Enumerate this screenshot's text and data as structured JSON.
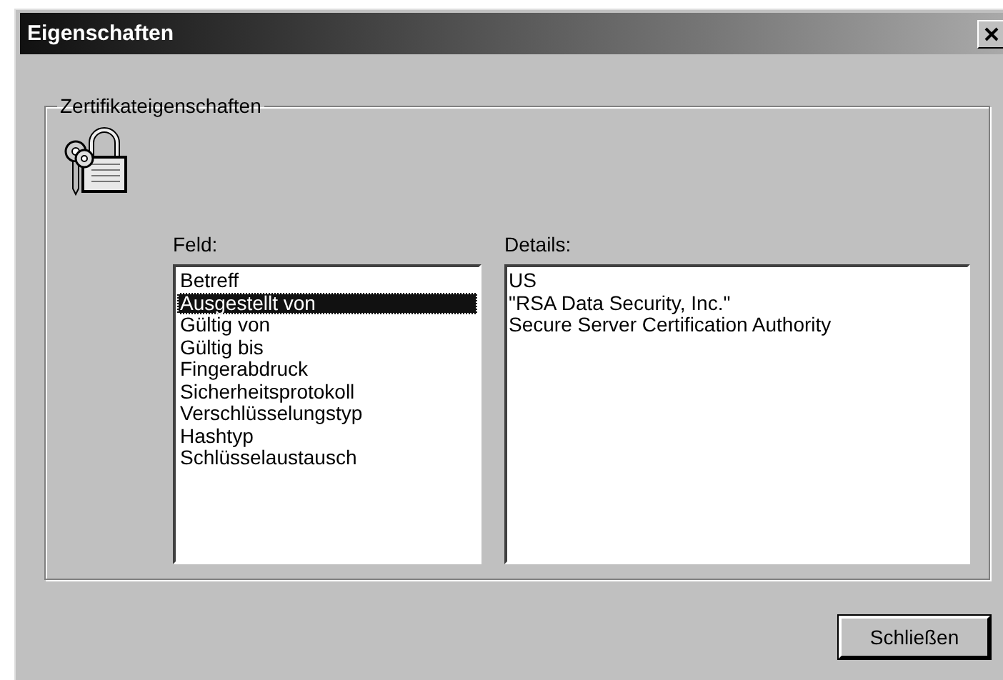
{
  "window": {
    "title": "Eigenschaften"
  },
  "group": {
    "title": "Zertifikateigenschaften"
  },
  "field_list": {
    "label": "Feld:",
    "items": [
      {
        "label": "Betreff",
        "selected": false
      },
      {
        "label": "Ausgestellt von",
        "selected": true
      },
      {
        "label": "Gültig von",
        "selected": false
      },
      {
        "label": "Gültig bis",
        "selected": false
      },
      {
        "label": "Fingerabdruck",
        "selected": false
      },
      {
        "label": "Sicherheitsprotokoll",
        "selected": false
      },
      {
        "label": "Verschlüsselungstyp",
        "selected": false
      },
      {
        "label": "Hashtyp",
        "selected": false
      },
      {
        "label": "Schlüsselaustausch",
        "selected": false
      }
    ]
  },
  "details": {
    "label": "Details:",
    "lines": [
      "US",
      "\"RSA Data Security, Inc.\"",
      "Secure Server Certification Authority"
    ]
  },
  "buttons": [
    "Schließen"
  ]
}
